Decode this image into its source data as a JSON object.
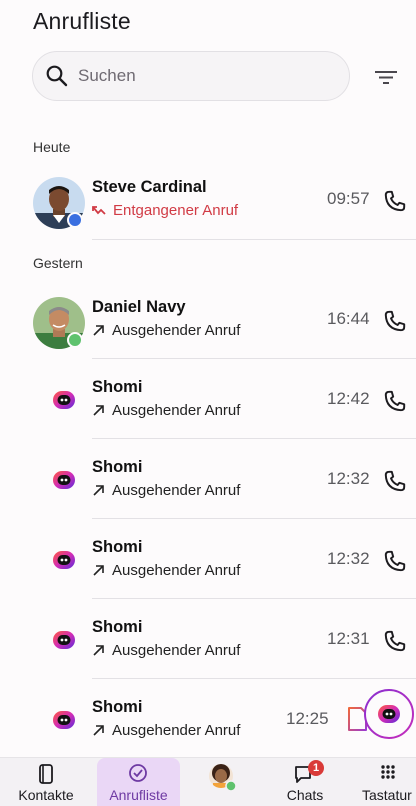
{
  "header": {
    "title": "Anrufliste"
  },
  "search": {
    "placeholder": "Suchen",
    "icon": "search-icon"
  },
  "filter": {
    "icon": "filter-icon"
  },
  "sections": {
    "today": "Heute",
    "yesterday": "Gestern"
  },
  "calls": [
    {
      "name": "Steve Cardinal",
      "status": "Entgangener Anruf",
      "kind": "missed",
      "time": "09:57",
      "avatar": "photo",
      "presence": "#3a6fe0"
    },
    {
      "name": "Daniel Navy",
      "status": "Ausgehender Anruf",
      "kind": "outgoing",
      "time": "16:44",
      "avatar": "photo",
      "presence": "#5fc26e"
    },
    {
      "name": "Shomi",
      "status": "Ausgehender Anruf",
      "kind": "outgoing",
      "time": "12:42",
      "avatar": "shomi"
    },
    {
      "name": "Shomi",
      "status": "Ausgehender Anruf",
      "kind": "outgoing",
      "time": "12:32",
      "avatar": "shomi"
    },
    {
      "name": "Shomi",
      "status": "Ausgehender Anruf",
      "kind": "outgoing",
      "time": "12:32",
      "avatar": "shomi"
    },
    {
      "name": "Shomi",
      "status": "Ausgehender Anruf",
      "kind": "outgoing",
      "time": "12:31",
      "avatar": "shomi"
    },
    {
      "name": "Shomi",
      "status": "Ausgehender Anruf",
      "kind": "outgoing",
      "time": "12:25",
      "avatar": "shomi"
    }
  ],
  "nav": {
    "contacts": "Kontakte",
    "calls": "Anrufliste",
    "chats": "Chats",
    "chats_badge": "1",
    "keypad": "Tastatur"
  },
  "colors": {
    "accent": "#6e3aa3",
    "missed": "#d13b45",
    "active_tab": "#ead7f6",
    "badge": "#d93a38"
  }
}
